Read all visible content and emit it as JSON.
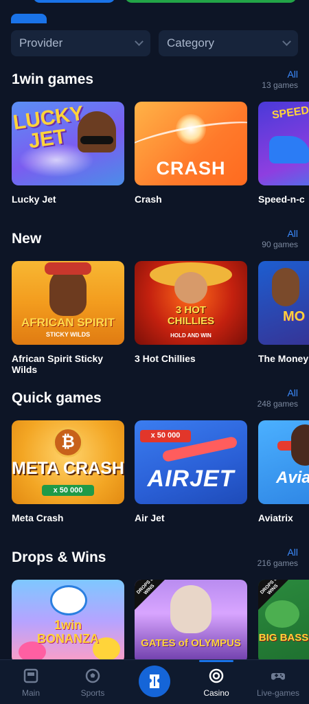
{
  "filters": {
    "provider_label": "Provider",
    "category_label": "Category"
  },
  "sections": [
    {
      "title": "1win games",
      "all_label": "All",
      "count": "13 games",
      "games": [
        {
          "name": "Lucky Jet",
          "art_text": "LUCKY JET"
        },
        {
          "name": "Crash",
          "art_text": "CRASH"
        },
        {
          "name": "Speed-n-c",
          "art_text": "SPEED"
        }
      ]
    },
    {
      "title": "New",
      "all_label": "All",
      "count": "90 games",
      "games": [
        {
          "name": "African Spirit Sticky Wilds",
          "art_text": "AFRICAN SPIRIT",
          "art_sub": "STICKY WILDS"
        },
        {
          "name": "3 Hot Chillies",
          "art_text": "3 HOT CHILLIES",
          "art_sub": "HOLD AND WIN"
        },
        {
          "name": "The Money Megaways",
          "art_text": "MO"
        }
      ]
    },
    {
      "title": "Quick games",
      "all_label": "All",
      "count": "248 games",
      "games": [
        {
          "name": "Meta Crash",
          "art_text": "META CRASH",
          "art_sub": "x 50 000"
        },
        {
          "name": "Air Jet",
          "art_text": "AIRJET",
          "art_sub": "x 50 000"
        },
        {
          "name": "Aviatrix",
          "art_text": "Avia"
        }
      ]
    },
    {
      "title": "Drops & Wins",
      "all_label": "All",
      "count": "216 games",
      "games": [
        {
          "name": "1win Bonanza",
          "art_text": "1win BONANZA"
        },
        {
          "name": "Gates of Olympus",
          "art_text": "GATES of OLYMPUS",
          "art_sub": "DROPS & WINS"
        },
        {
          "name": "Big Bass Amazon Xtreme",
          "art_text": "BIG BASS",
          "art_sub": "DROPS & WINS"
        }
      ]
    }
  ],
  "nav": {
    "main": "Main",
    "sports": "Sports",
    "casino": "Casino",
    "live_games": "Live-games"
  },
  "colors": {
    "background": "#0d1526",
    "accent": "#1a73e8",
    "link": "#3d8bfd"
  }
}
